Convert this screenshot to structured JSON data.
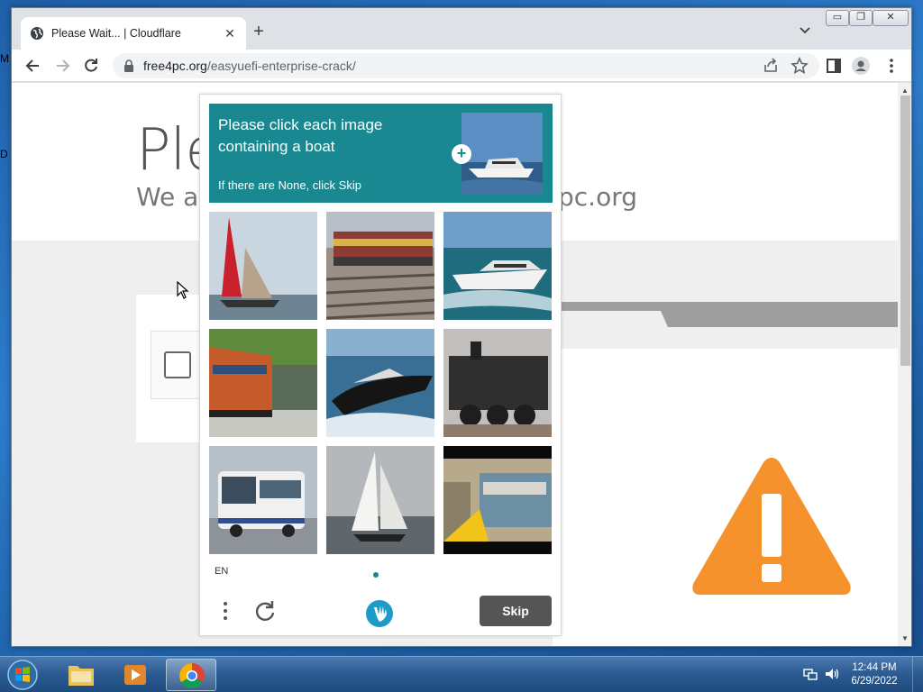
{
  "desktop": {
    "edge_text_1": "M",
    "edge_text_2": "D"
  },
  "browser": {
    "tab_title": "Please Wait... | Cloudflare",
    "tab_close": "✕",
    "new_tab": "+",
    "window_controls": {
      "minimize": "▭",
      "restore": "❐",
      "close": "✕"
    },
    "url_host": "free4pc.org",
    "url_path": "/easyuefi-enterprise-crack/"
  },
  "page": {
    "heading_fragment": "Ple",
    "subheading_fragment": "We ar",
    "subheading_tail": "pc.org",
    "warning_color": "#f5922b"
  },
  "captcha": {
    "prompt": "Please click each image containing a boat",
    "skip_hint": "If there are None, click Skip",
    "plus": "+",
    "language": "EN",
    "skip_label": "Skip",
    "accent_color": "#1a8890",
    "tiles": [
      {
        "icon": "sailboat-red-sail"
      },
      {
        "icon": "train-on-tracks"
      },
      {
        "icon": "motor-yacht"
      },
      {
        "icon": "orange-locomotive"
      },
      {
        "icon": "speedboat"
      },
      {
        "icon": "steam-locomotive"
      },
      {
        "icon": "city-bus"
      },
      {
        "icon": "sailboat-white-sail"
      },
      {
        "icon": "subway-train"
      }
    ]
  },
  "taskbar": {
    "time": "12:44 PM",
    "date": "6/29/2022"
  }
}
